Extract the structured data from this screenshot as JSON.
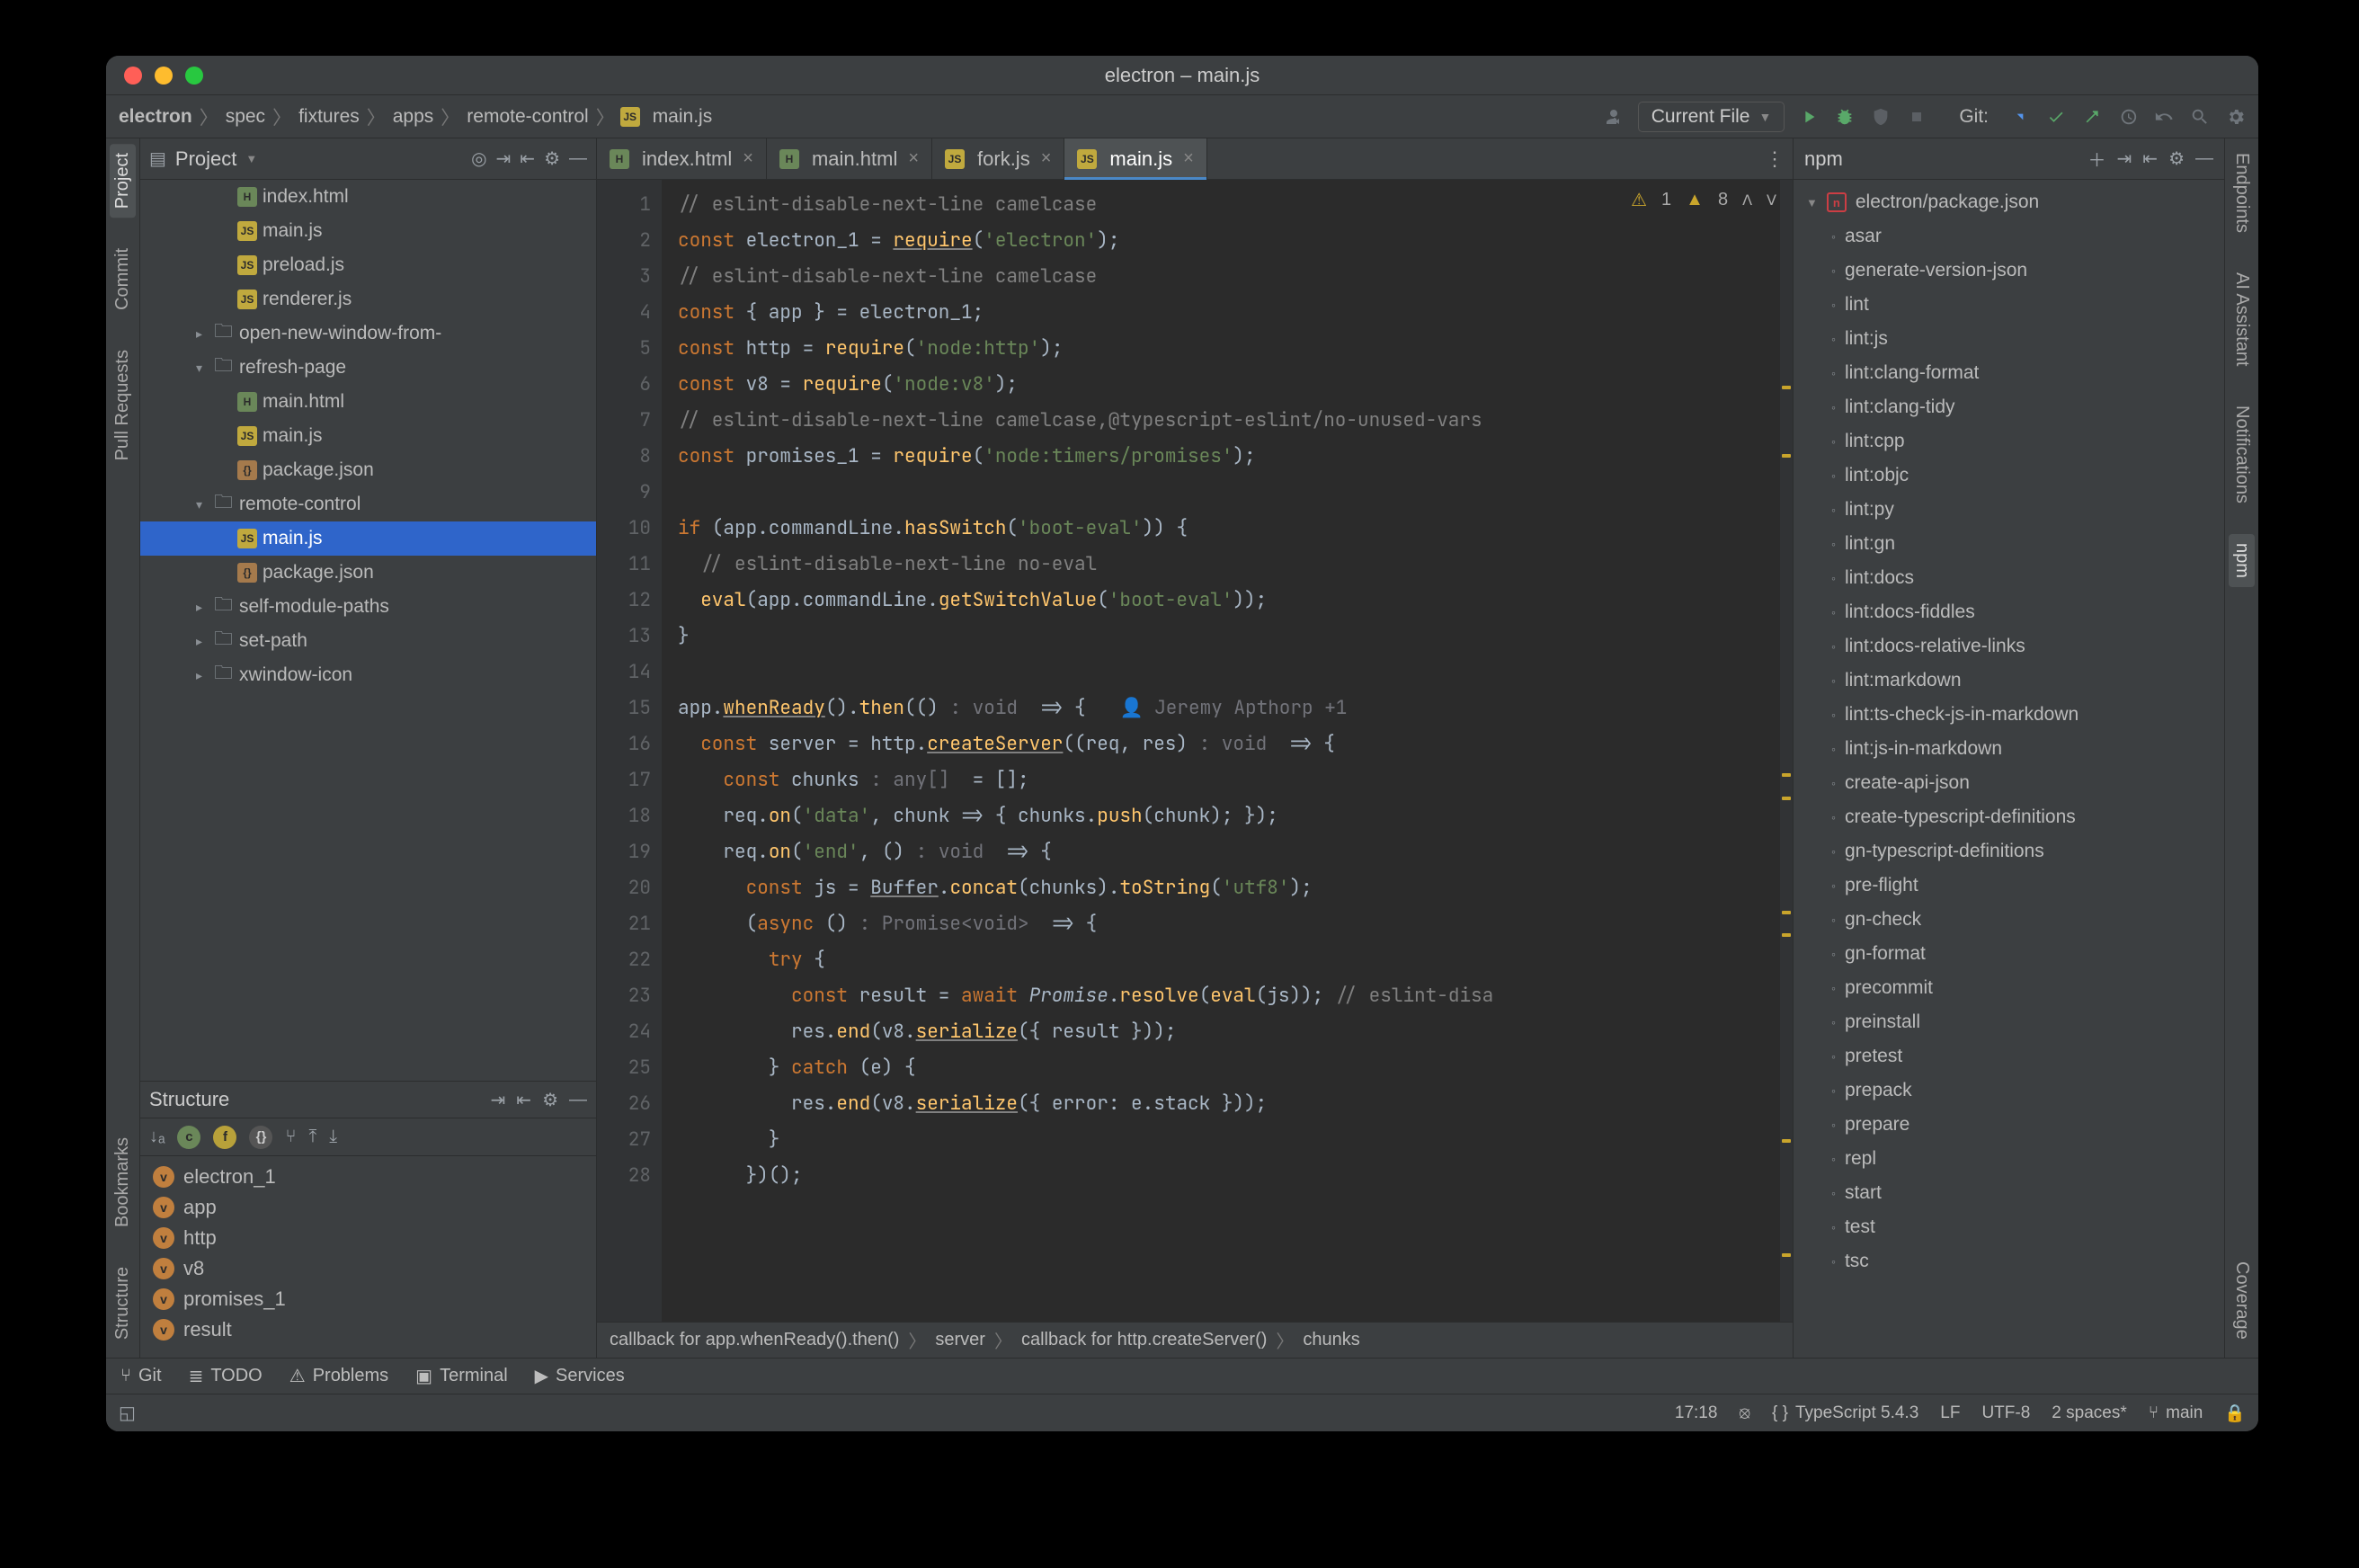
{
  "window_title": "electron – main.js",
  "breadcrumbs": [
    "electron",
    "spec",
    "fixtures",
    "apps",
    "remote-control",
    "main.js"
  ],
  "run_config": "Current File",
  "git_label": "Git:",
  "left_tabs": [
    "Project",
    "Commit",
    "Pull Requests",
    "Bookmarks",
    "Structure"
  ],
  "right_tabs": [
    "Endpoints",
    "AI Assistant",
    "Notifications",
    "npm",
    "Coverage"
  ],
  "project_panel_title": "Project",
  "tree": [
    {
      "depth": 3,
      "kind": "html",
      "name": "index.html"
    },
    {
      "depth": 3,
      "kind": "js",
      "name": "main.js"
    },
    {
      "depth": 3,
      "kind": "js",
      "name": "preload.js"
    },
    {
      "depth": 3,
      "kind": "js",
      "name": "renderer.js"
    },
    {
      "depth": 2,
      "kind": "folder",
      "caret": "right",
      "name": "open-new-window-from-"
    },
    {
      "depth": 2,
      "kind": "folder",
      "caret": "down",
      "name": "refresh-page"
    },
    {
      "depth": 3,
      "kind": "html",
      "name": "main.html"
    },
    {
      "depth": 3,
      "kind": "js",
      "name": "main.js"
    },
    {
      "depth": 3,
      "kind": "json",
      "name": "package.json"
    },
    {
      "depth": 2,
      "kind": "folder",
      "caret": "down",
      "name": "remote-control"
    },
    {
      "depth": 3,
      "kind": "js",
      "name": "main.js",
      "selected": true
    },
    {
      "depth": 3,
      "kind": "json",
      "name": "package.json"
    },
    {
      "depth": 2,
      "kind": "folder",
      "caret": "right",
      "name": "self-module-paths"
    },
    {
      "depth": 2,
      "kind": "folder",
      "caret": "right",
      "name": "set-path"
    },
    {
      "depth": 2,
      "kind": "folder",
      "caret": "right",
      "name": "xwindow-icon"
    }
  ],
  "structure_title": "Structure",
  "structure_items": [
    "electron_1",
    "app",
    "http",
    "v8",
    "promises_1",
    "result"
  ],
  "editor_tabs": [
    {
      "icon": "html",
      "name": "index.html"
    },
    {
      "icon": "html",
      "name": "main.html"
    },
    {
      "icon": "js",
      "name": "fork.js"
    },
    {
      "icon": "js",
      "name": "main.js",
      "active": true
    }
  ],
  "inspection": {
    "err_count": "1",
    "warn_count": "8"
  },
  "author_inlay": "Jeremy Apthorp +1",
  "code_crumbs": [
    "callback for app.whenReady().then()",
    "server",
    "callback for http.createServer()",
    "chunks"
  ],
  "npm_title": "npm",
  "npm_root": "electron/package.json",
  "npm_scripts": [
    "asar",
    "generate-version-json",
    "lint",
    "lint:js",
    "lint:clang-format",
    "lint:clang-tidy",
    "lint:cpp",
    "lint:objc",
    "lint:py",
    "lint:gn",
    "lint:docs",
    "lint:docs-fiddles",
    "lint:docs-relative-links",
    "lint:markdown",
    "lint:ts-check-js-in-markdown",
    "lint:js-in-markdown",
    "create-api-json",
    "create-typescript-definitions",
    "gn-typescript-definitions",
    "pre-flight",
    "gn-check",
    "gn-format",
    "precommit",
    "preinstall",
    "pretest",
    "prepack",
    "prepare",
    "repl",
    "start",
    "test",
    "tsc"
  ],
  "tool_windows": [
    "Git",
    "TODO",
    "Problems",
    "Terminal",
    "Services"
  ],
  "status": {
    "caret": "17:18",
    "lang": "TypeScript 5.4.3",
    "lf": "LF",
    "enc": "UTF-8",
    "indent": "2 spaces*",
    "branch": "main"
  },
  "line_numbers": [
    "1",
    "2",
    "3",
    "4",
    "5",
    "6",
    "7",
    "8",
    "9",
    "10",
    "11",
    "12",
    "13",
    "14",
    "15",
    "16",
    "17",
    "18",
    "19",
    "20",
    "21",
    "22",
    "23",
    "24",
    "25",
    "26",
    "27",
    "28"
  ]
}
